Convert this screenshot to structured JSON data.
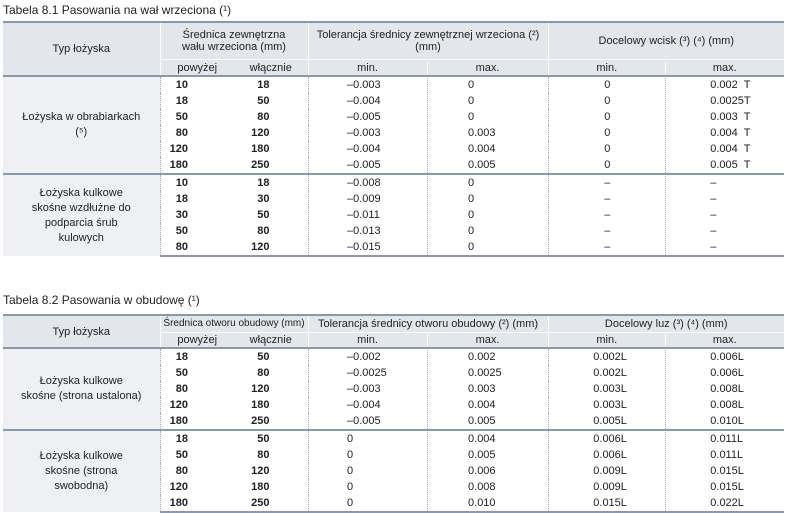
{
  "table1": {
    "caption": "Tabela 8.1  Pasowania na wał wrzeciona (¹)",
    "headers": {
      "type": "Typ łożyska",
      "diameter": "Średnica zewnętrzna wału wrzeciona (mm)",
      "tolerance": "Tolerancja średnicy zewnętrznej wrzeciona (²) (mm)",
      "target": "Docelowy wcisk (³) (⁴) (mm)",
      "above": "powyżej",
      "incl": "włącznie",
      "min": "min.",
      "max": "max."
    },
    "groups": [
      {
        "type": "Łożyska w obrabiarkach (⁵)",
        "rows": [
          [
            "10",
            "18",
            "–0.003",
            "0",
            "0",
            "0.002  T"
          ],
          [
            "18",
            "50",
            "–0.004",
            "0",
            "0",
            "0.0025T"
          ],
          [
            "50",
            "80",
            "–0.005",
            "0",
            "0",
            "0.003  T"
          ],
          [
            "80",
            "120",
            "–0.003",
            "0.003",
            "0",
            "0.004  T"
          ],
          [
            "120",
            "180",
            "–0.004",
            "0.004",
            "0",
            "0.004  T"
          ],
          [
            "180",
            "250",
            "–0.005",
            "0.005",
            "0",
            "0.005  T"
          ]
        ]
      },
      {
        "type": "Łożyska kulkowe skośne wzdłużne do podparcia śrub kulowych",
        "rows": [
          [
            "10",
            "18",
            "–0.008",
            "0",
            "–",
            "–"
          ],
          [
            "18",
            "30",
            "–0.009",
            "0",
            "–",
            "–"
          ],
          [
            "30",
            "50",
            "–0.011",
            "0",
            "–",
            "–"
          ],
          [
            "50",
            "80",
            "–0.013",
            "0",
            "–",
            "–"
          ],
          [
            "80",
            "120",
            "–0.015",
            "0",
            "–",
            "–"
          ]
        ]
      }
    ]
  },
  "table2": {
    "caption": "Tabela 8.2  Pasowania w obudowę (¹)",
    "headers": {
      "type": "Typ łożyska",
      "diameter": "Średnica otworu obudowy (mm)",
      "tolerance": "Tolerancja średnicy otworu obudowy (²) (mm)",
      "target": "Docelowy luz (³) (⁴) (mm)",
      "above": "powyżej",
      "incl": "włącznie",
      "min": "min.",
      "max": "max."
    },
    "groups": [
      {
        "type": "Łożyska kulkowe skośne (strona ustalona)",
        "rows": [
          [
            "18",
            "50",
            "–0.002",
            "0.002",
            "0.002L",
            "0.006L"
          ],
          [
            "50",
            "80",
            "–0.0025",
            "0.0025",
            "0.002L",
            "0.006L"
          ],
          [
            "80",
            "120",
            "–0.003",
            "0.003",
            "0.003L",
            "0.008L"
          ],
          [
            "120",
            "180",
            "–0.004",
            "0.004",
            "0.003L",
            "0.008L"
          ],
          [
            "180",
            "250",
            "–0.005",
            "0.005",
            "0.005L",
            "0.010L"
          ]
        ]
      },
      {
        "type": "Łożyska kulkowe skośne (strona swobodna)",
        "rows": [
          [
            "18",
            "50",
            "0",
            "0.004",
            "0.006L",
            "0.011L"
          ],
          [
            "50",
            "80",
            "0",
            "0.005",
            "0.006L",
            "0.011L"
          ],
          [
            "80",
            "120",
            "0",
            "0.006",
            "0.009L",
            "0.015L"
          ],
          [
            "120",
            "180",
            "0",
            "0.008",
            "0.009L",
            "0.015L"
          ],
          [
            "180",
            "250",
            "0",
            "0.010",
            "0.015L",
            "0.022L"
          ]
        ]
      }
    ]
  }
}
